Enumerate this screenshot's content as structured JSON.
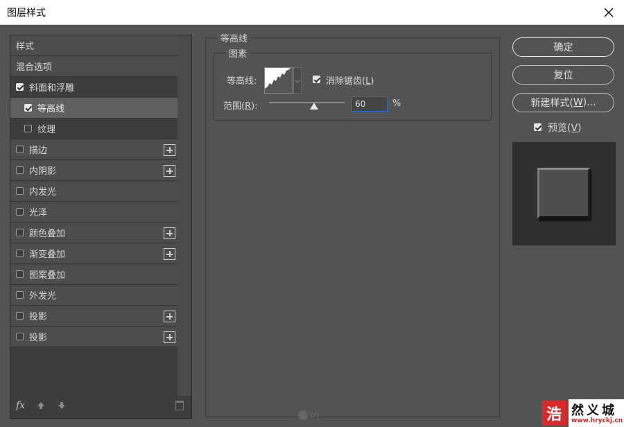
{
  "window": {
    "title": "图层样式"
  },
  "left": {
    "header": "样式",
    "blend_options": "混合选项",
    "bevel": {
      "label": "斜面和浮雕",
      "checked": true
    },
    "contour": {
      "label": "等高线",
      "checked": true
    },
    "texture": {
      "label": "纹理",
      "checked": false
    },
    "effects": [
      {
        "label": "描边",
        "plus": true
      },
      {
        "label": "内阴影",
        "plus": true
      },
      {
        "label": "内发光",
        "plus": false
      },
      {
        "label": "光泽",
        "plus": false
      },
      {
        "label": "颜色叠加",
        "plus": true
      },
      {
        "label": "渐变叠加",
        "plus": true
      },
      {
        "label": "图案叠加",
        "plus": false
      },
      {
        "label": "外发光",
        "plus": false
      },
      {
        "label": "投影",
        "plus": true
      },
      {
        "label": "投影",
        "plus": true
      }
    ],
    "footer": {
      "fx": "fx"
    }
  },
  "center": {
    "group_title": "等高线",
    "sub_title": "图素",
    "contour_label": "等高线:",
    "anti_alias_label": "消除锯齿(",
    "anti_alias_key": "L",
    "anti_alias_close": ")",
    "range_label_pre": "范围(",
    "range_key": "R",
    "range_label_post": "):",
    "range_value": "60",
    "range_unit": "%",
    "range_fraction": 0.6
  },
  "right": {
    "ok": "确定",
    "reset": "复位",
    "new_style_pre": "新建样式(",
    "new_style_key": "W",
    "new_style_post": ")...",
    "preview_pre": "预览(",
    "preview_key": "V",
    "preview_post": ")",
    "preview_checked": true
  },
  "watermark": {
    "ui": "cn",
    "site": "www.hryckj.cn",
    "brand": "然义城",
    "badge": "浩"
  }
}
